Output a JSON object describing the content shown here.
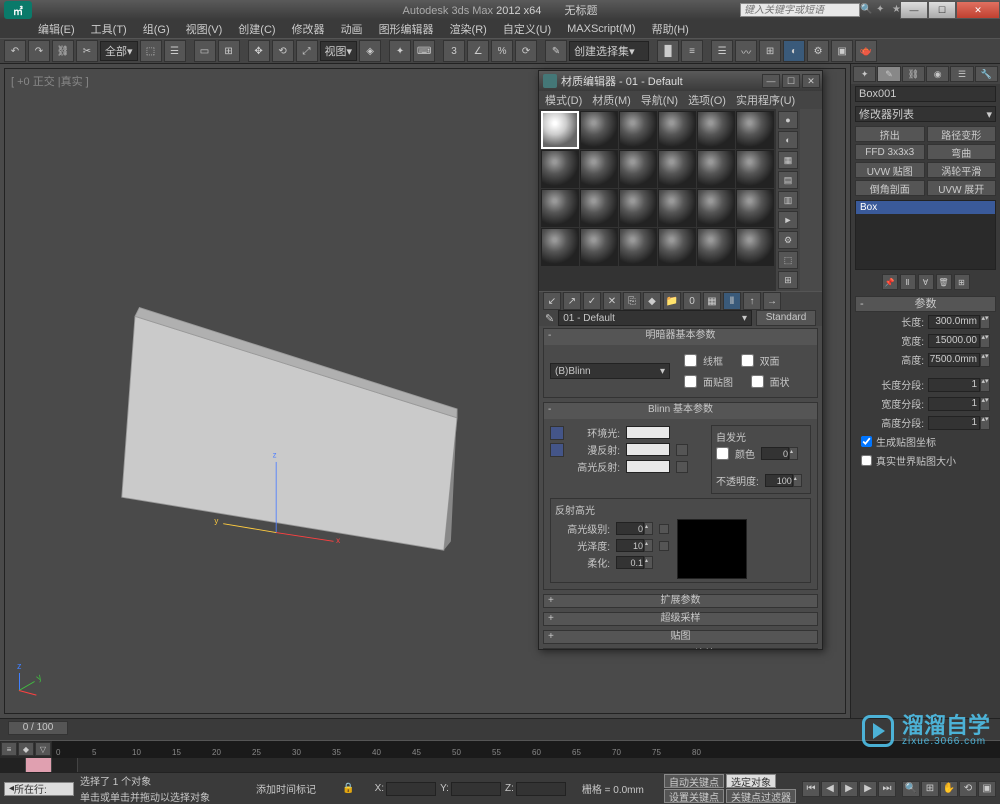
{
  "title": {
    "app": "Autodesk 3ds Max",
    "version": "2012 x64",
    "doc": "无标题",
    "search_placeholder": "键入关键字或短语"
  },
  "menu": [
    "编辑(E)",
    "工具(T)",
    "组(G)",
    "视图(V)",
    "创建(C)",
    "修改器",
    "动画",
    "图形编辑器",
    "渲染(R)",
    "自定义(U)",
    "MAXScript(M)",
    "帮助(H)"
  ],
  "toolbar": {
    "scope": "全部",
    "view": "视图",
    "select_set": "创建选择集"
  },
  "viewport": {
    "label": "[ +0 正交 |真实 ]",
    "time_slider": "0 / 100"
  },
  "command_panel": {
    "object_name": "Box001",
    "modifier_dropdown": "修改器列表",
    "buttons": [
      "挤出",
      "路径变形",
      "FFD 3x3x3",
      "弯曲",
      "UVW 贴图",
      "涡轮平滑",
      "倒角剖面",
      "UVW 展开"
    ],
    "stack": [
      "Box"
    ],
    "rollout_title": "参数",
    "params": {
      "length_label": "长度:",
      "length": "300.0mm",
      "width_label": "宽度:",
      "width": "15000.00",
      "height_label": "高度:",
      "height": "7500.0mm",
      "lsegs_label": "长度分段:",
      "lsegs": "1",
      "wsegs_label": "宽度分段:",
      "wsegs": "1",
      "hsegs_label": "高度分段:",
      "hsegs": "1",
      "gen_uv": "生成贴图坐标",
      "real_world": "真实世界贴图大小"
    }
  },
  "material_editor": {
    "title": "材质编辑器 - 01 - Default",
    "menu": [
      "模式(D)",
      "材质(M)",
      "导航(N)",
      "选项(O)",
      "实用程序(U)"
    ],
    "mat_name": "01 - Default",
    "mat_type": "Standard",
    "shader_rollout": "明暗器基本参数",
    "shader": "(B)Blinn",
    "wire": "线框",
    "two_sided": "双面",
    "face_map": "面贴图",
    "faceted": "面状",
    "blinn_rollout": "Blinn 基本参数",
    "ambient": "环境光:",
    "diffuse": "漫反射:",
    "specular": "高光反射:",
    "self_illum_group": "自发光",
    "color_chk": "颜色",
    "color_val": "0",
    "opacity": "不透明度:",
    "opacity_val": "100",
    "spec_group": "反射高光",
    "spec_level": "高光级别:",
    "spec_level_val": "0",
    "gloss": "光泽度:",
    "gloss_val": "10",
    "soften": "柔化:",
    "soften_val": "0.1",
    "mini_rollouts": [
      "扩展参数",
      "超级采样",
      "贴图",
      "mental ray 连接"
    ]
  },
  "status": {
    "selected": "选择了 1 个对象",
    "hint": "单击或单击并拖动以选择对象",
    "add_time": "添加时间标记",
    "grid": "栅格 = 0.0mm",
    "auto_key": "自动关键点",
    "sel_lock": "选定对象",
    "set_key": "设置关键点",
    "key_filter": "关键点过滤器",
    "prompt": "所在行:"
  },
  "watermark": {
    "brand": "溜溜自学",
    "url": "zixue.3066.com"
  }
}
